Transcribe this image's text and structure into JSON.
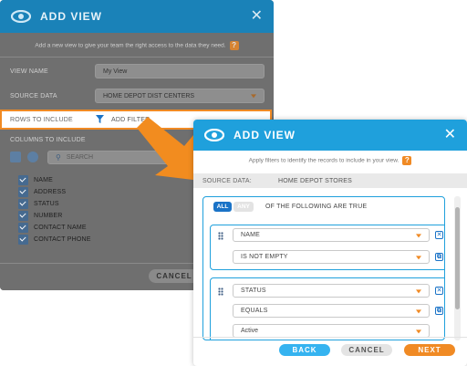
{
  "back_dialog": {
    "title": "ADD VIEW",
    "subtitle": "Add a new view to give your team the right access to the data they need.",
    "help": "?",
    "view_name_label": "VIEW NAME",
    "view_name_value": "My View",
    "source_data_label": "SOURCE DATA",
    "source_data_value": "HOME DEPOT DIST CENTERS",
    "rows_label": "ROWS TO INCLUDE",
    "add_filter_label": "ADD FILTER",
    "columns_label": "COLUMNS TO INCLUDE",
    "search_placeholder": "SEARCH",
    "columns": [
      "NAME",
      "ADDRESS",
      "STATUS",
      "NUMBER",
      "CONTACT NAME",
      "CONTACT PHONE"
    ],
    "cancel_label": "CANCEL"
  },
  "front_dialog": {
    "title": "ADD VIEW",
    "subtitle": "Apply filters to identify the records to include in your view.",
    "help": "?",
    "source_label": "SOURCE DATA:",
    "source_value": "HOME DEPOT STORES",
    "all_label": "ALL",
    "any_label": "ANY",
    "condition_text": "OF THE FOLLOWING ARE TRUE",
    "filters": [
      {
        "field": "NAME",
        "operator": "IS NOT EMPTY"
      },
      {
        "field": "STATUS",
        "operator": "EQUALS",
        "value": "Active"
      }
    ],
    "back_label": "BACK",
    "cancel_label": "CANCEL",
    "next_label": "NEXT"
  },
  "colors": {
    "header": "#1fa0dc",
    "accent_orange": "#f08a24",
    "button_blue": "#35b3f0"
  },
  "icons": [
    "logo-swirl-icon",
    "close-icon",
    "filter-funnel-icon",
    "search-icon",
    "drag-grip-icon",
    "remove-icon",
    "copy-icon",
    "chevron-down-icon",
    "arrow-pointer-icon"
  ]
}
